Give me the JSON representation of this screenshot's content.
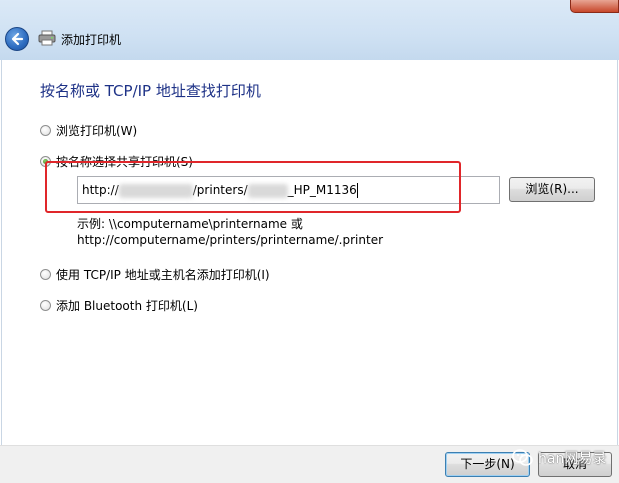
{
  "window": {
    "title": "添加打印机"
  },
  "page": {
    "heading": "按名称或 TCP/IP 地址查找打印机"
  },
  "options": [
    {
      "label": "浏览打印机(W)",
      "checked": false
    },
    {
      "label": "按名称选择共享打印机(S)",
      "checked": true
    },
    {
      "label": "使用 TCP/IP 地址或主机名添加打印机(I)",
      "checked": false
    },
    {
      "label": "添加 Bluetooth 打印机(L)",
      "checked": false
    }
  ],
  "shared_printer": {
    "url_prefix": "http://",
    "url_middle": "/printers/",
    "url_suffix": "_HP_M1136",
    "browse_label": "浏览(R)...",
    "example_line1": "示例: \\\\computername\\printername 或",
    "example_line2": "http://computername/printers/printername/.printer"
  },
  "footer": {
    "next_label": "下一步(N)",
    "cancel_label": "取消"
  },
  "watermark": {
    "text": "han网易录"
  },
  "colors": {
    "heading": "#1e3287",
    "annotation": "#e0262a"
  }
}
